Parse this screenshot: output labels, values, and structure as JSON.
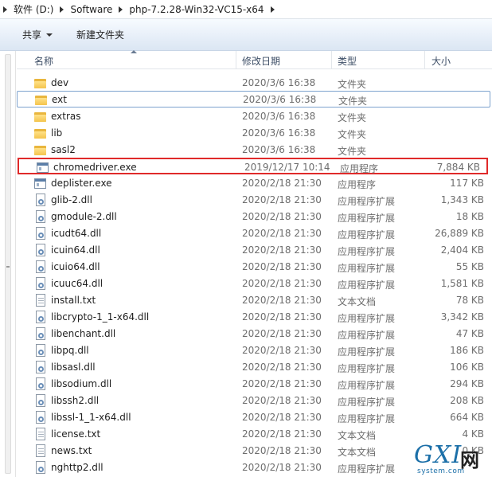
{
  "breadcrumb": [
    "软件 (D:)",
    "Software",
    "php-7.2.28-Win32-VC15-x64"
  ],
  "toolbar": {
    "share_label": "共享",
    "new_folder_label": "新建文件夹"
  },
  "columns": {
    "name": "名称",
    "date": "修改日期",
    "type": "类型",
    "size": "大小"
  },
  "files": [
    {
      "name": "dev",
      "date": "2020/3/6 16:38",
      "type": "文件夹",
      "size": "",
      "icon": "folder-icon"
    },
    {
      "name": "ext",
      "date": "2020/3/6 16:38",
      "type": "文件夹",
      "size": "",
      "icon": "folder-icon"
    },
    {
      "name": "extras",
      "date": "2020/3/6 16:38",
      "type": "文件夹",
      "size": "",
      "icon": "folder-icon"
    },
    {
      "name": "lib",
      "date": "2020/3/6 16:38",
      "type": "文件夹",
      "size": "",
      "icon": "folder-icon"
    },
    {
      "name": "sasl2",
      "date": "2020/3/6 16:38",
      "type": "文件夹",
      "size": "",
      "icon": "folder-icon"
    },
    {
      "name": "chromedriver.exe",
      "date": "2019/12/17 10:14",
      "type": "应用程序",
      "size": "7,884 KB",
      "icon": "exe-icon"
    },
    {
      "name": "deplister.exe",
      "date": "2020/2/18 21:30",
      "type": "应用程序",
      "size": "117 KB",
      "icon": "exe-icon"
    },
    {
      "name": "glib-2.dll",
      "date": "2020/2/18 21:30",
      "type": "应用程序扩展",
      "size": "1,343 KB",
      "icon": "dll-icon"
    },
    {
      "name": "gmodule-2.dll",
      "date": "2020/2/18 21:30",
      "type": "应用程序扩展",
      "size": "18 KB",
      "icon": "dll-icon"
    },
    {
      "name": "icudt64.dll",
      "date": "2020/2/18 21:30",
      "type": "应用程序扩展",
      "size": "26,889 KB",
      "icon": "dll-icon"
    },
    {
      "name": "icuin64.dll",
      "date": "2020/2/18 21:30",
      "type": "应用程序扩展",
      "size": "2,404 KB",
      "icon": "dll-icon"
    },
    {
      "name": "icuio64.dll",
      "date": "2020/2/18 21:30",
      "type": "应用程序扩展",
      "size": "55 KB",
      "icon": "dll-icon"
    },
    {
      "name": "icuuc64.dll",
      "date": "2020/2/18 21:30",
      "type": "应用程序扩展",
      "size": "1,581 KB",
      "icon": "dll-icon"
    },
    {
      "name": "install.txt",
      "date": "2020/2/18 21:30",
      "type": "文本文档",
      "size": "78 KB",
      "icon": "text-file-icon"
    },
    {
      "name": "libcrypto-1_1-x64.dll",
      "date": "2020/2/18 21:30",
      "type": "应用程序扩展",
      "size": "3,342 KB",
      "icon": "dll-icon"
    },
    {
      "name": "libenchant.dll",
      "date": "2020/2/18 21:30",
      "type": "应用程序扩展",
      "size": "47 KB",
      "icon": "dll-icon"
    },
    {
      "name": "libpq.dll",
      "date": "2020/2/18 21:30",
      "type": "应用程序扩展",
      "size": "186 KB",
      "icon": "dll-icon"
    },
    {
      "name": "libsasl.dll",
      "date": "2020/2/18 21:30",
      "type": "应用程序扩展",
      "size": "106 KB",
      "icon": "dll-icon"
    },
    {
      "name": "libsodium.dll",
      "date": "2020/2/18 21:30",
      "type": "应用程序扩展",
      "size": "294 KB",
      "icon": "dll-icon"
    },
    {
      "name": "libssh2.dll",
      "date": "2020/2/18 21:30",
      "type": "应用程序扩展",
      "size": "208 KB",
      "icon": "dll-icon"
    },
    {
      "name": "libssl-1_1-x64.dll",
      "date": "2020/2/18 21:30",
      "type": "应用程序扩展",
      "size": "664 KB",
      "icon": "dll-icon"
    },
    {
      "name": "license.txt",
      "date": "2020/2/18 21:30",
      "type": "文本文档",
      "size": "4 KB",
      "icon": "text-file-icon"
    },
    {
      "name": "news.txt",
      "date": "2020/2/18 21:30",
      "type": "文本文档",
      "size": "0 KB",
      "icon": "text-file-icon"
    },
    {
      "name": "nghttp2.dll",
      "date": "2020/2/18 21:30",
      "type": "应用程序扩展",
      "size": "",
      "icon": "dll-icon"
    }
  ],
  "selected_index": 1,
  "highlighted_index": 5,
  "watermark": {
    "logo": "GXI",
    "net": "网",
    "site": "system.com"
  },
  "colors": {
    "highlight_box": "#e02a2a",
    "selection_border": "#7da2ce",
    "watermark": "#1b6fa8"
  }
}
